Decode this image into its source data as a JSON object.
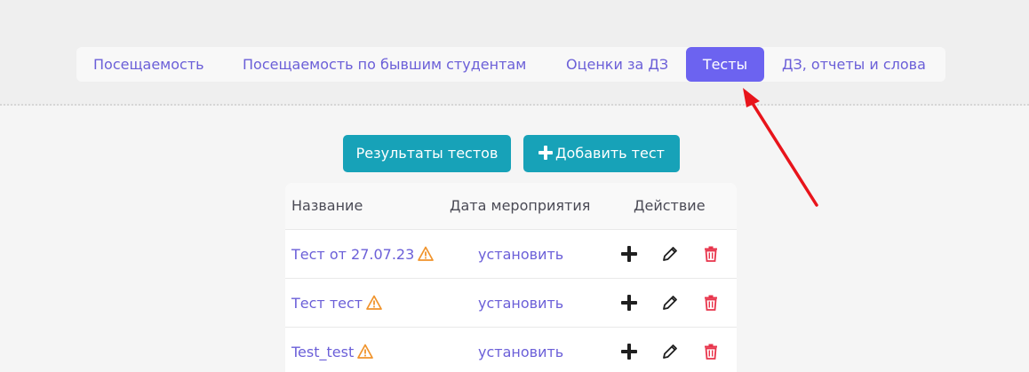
{
  "tabs": [
    {
      "label": "Посещаемость",
      "active": false
    },
    {
      "label": "Посещаемость по бывшим студентам",
      "active": false
    },
    {
      "label": "Оценки за ДЗ",
      "active": false
    },
    {
      "label": "Тесты",
      "active": true
    },
    {
      "label": "ДЗ, отчеты и слова",
      "active": false
    }
  ],
  "buttons": {
    "results_label": "Результаты тестов",
    "add_label": "Добавить тест"
  },
  "table": {
    "headers": [
      "Название",
      "Дата мероприятия",
      "Действие"
    ],
    "rows": [
      {
        "name": "Тест от 27.07.23",
        "date": "установить"
      },
      {
        "name": "Тест тест",
        "date": "установить"
      },
      {
        "name": "Test_test",
        "date": "установить"
      }
    ]
  },
  "colors": {
    "accent": "#6c63f0",
    "link": "#6b5fd8",
    "button": "#17a2b8",
    "warning": "#f0932b",
    "delete": "#e8344b",
    "annotation_arrow": "#e8141b"
  },
  "icons": {
    "add": "plus-icon",
    "edit": "pencil-icon",
    "delete": "trash-icon",
    "warning": "warning-triangle-icon"
  }
}
